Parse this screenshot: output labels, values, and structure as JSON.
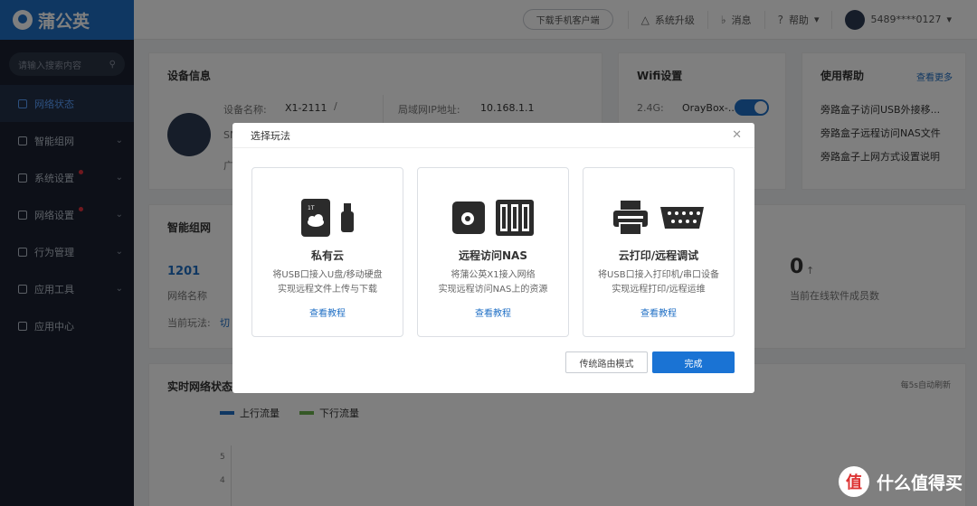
{
  "app": {
    "name": "蒲公英"
  },
  "sidebar": {
    "search_placeholder": "请输入搜索内容",
    "items": [
      {
        "label": "网络状态"
      },
      {
        "label": "智能组网"
      },
      {
        "label": "系统设置"
      },
      {
        "label": "网络设置"
      },
      {
        "label": "行为管理"
      },
      {
        "label": "应用工具"
      },
      {
        "label": "应用中心"
      }
    ]
  },
  "header": {
    "download_label": "下载手机客户端",
    "upgrade_label": "系统升级",
    "message_label": "消息",
    "help_label": "帮助",
    "user_label": "5489****0127"
  },
  "device_info": {
    "title": "设备信息",
    "name_label": "设备名称:",
    "name_value": "X1-2111",
    "ip_label": "局域网IP地址:",
    "ip_value": "10.168.1.1",
    "sn_partial": "SN",
    "guang_partial": "广"
  },
  "wifi": {
    "title": "Wifi设置",
    "band": "2.4G:",
    "ssid": "OrayBox-..."
  },
  "help_box": {
    "title": "使用帮助",
    "more": "查看更多",
    "items": [
      "旁路盒子访问USB外接移...",
      "旁路盒子远程访问NAS文件",
      "旁路盒子上网方式设置说明"
    ]
  },
  "smart_net": {
    "title": "智能组网",
    "network_id": "1201",
    "network_name_label": "网络名称",
    "current_mode_label": "当前玩法:",
    "current_mode_value": "切",
    "online_count": "0",
    "online_label": "当前在线软件成员数"
  },
  "realtime": {
    "title": "实时网络状态",
    "auto_refresh": "每5s自动刷新",
    "legend_up": "上行流量",
    "legend_down": "下行流量",
    "y_ticks": [
      "5",
      "4"
    ]
  },
  "modal": {
    "title": "选择玩法",
    "options": [
      {
        "title": "私有云",
        "desc1": "将USB口接入U盘/移动硬盘",
        "desc2": "实现远程文件上传与下载",
        "link": "查看教程"
      },
      {
        "title": "远程访问NAS",
        "desc1": "将蒲公英X1接入网络",
        "desc2": "实现远程访问NAS上的资源",
        "link": "查看教程"
      },
      {
        "title": "云打印/远程调试",
        "desc1": "将USB口接入打印机/串口设备",
        "desc2": "实现远程打印/远程运维",
        "link": "查看教程"
      }
    ],
    "secondary_button": "传统路由模式",
    "primary_button": "完成"
  },
  "watermark": {
    "text": "什么值得买",
    "logo_char": "值"
  },
  "colors": {
    "brand": "#1f6fc5",
    "sidebar_bg": "#1a2130",
    "primary_button": "#1a73d4"
  }
}
